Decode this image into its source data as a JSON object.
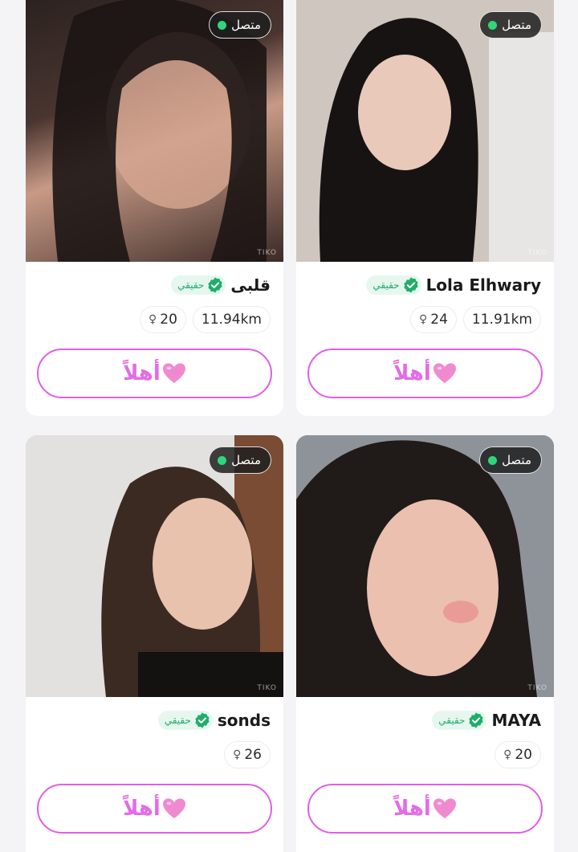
{
  "cards": [
    {
      "online_label": "متصل",
      "name": "قلبى",
      "verified_label": "حقيقي",
      "age": "20",
      "distance": "11.94km",
      "hello_label": "أهلاً",
      "watermark": "TIKO"
    },
    {
      "online_label": "متصل",
      "name": "Lola Elhwary",
      "verified_label": "حقيقي",
      "age": "24",
      "distance": "11.91km",
      "hello_label": "أهلاً",
      "watermark": "TIKO"
    },
    {
      "online_label": "متصل",
      "name": "sonds",
      "verified_label": "حقيقي",
      "age": "26",
      "hello_label": "أهلاً",
      "watermark": "TIKO"
    },
    {
      "online_label": "متصل",
      "name": "MAYA",
      "verified_label": "حقيقي",
      "age": "20",
      "hello_label": "أهلاً",
      "watermark": "TIKO"
    }
  ],
  "colors": {
    "online": "#2fd67a",
    "verified": "#1fae6a",
    "button_border": "#e15ee6",
    "button_text": "#e46be8",
    "heart": "#f08ad0"
  },
  "icons": {
    "online": "online-dot-icon",
    "verified": "verified-check-icon",
    "age": "female-symbol-icon",
    "hello": "heart-icon"
  }
}
